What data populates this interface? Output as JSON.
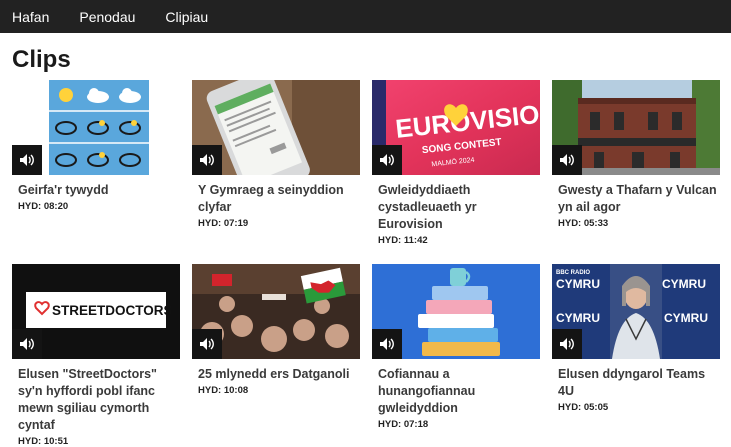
{
  "nav": {
    "items": [
      "Hafan",
      "Penodau",
      "Clipiau"
    ]
  },
  "page": {
    "title": "Clips"
  },
  "clips": [
    {
      "title": "Geirfa'r tywydd",
      "duration": "HYD: 08:20",
      "thumb": "weather-icons-grid"
    },
    {
      "title": "Y Gymraeg a seinyddion clyfar",
      "duration": "HYD: 07:19",
      "thumb": "phone-app-screenshot"
    },
    {
      "title": "Gwleidyddiaeth cystadleuaeth yr Eurovision",
      "duration": "HYD: 11:42",
      "thumb": "eurovision-banner",
      "thumb_text": [
        "EUROVISION",
        "SONG CONTEST",
        "MALMÖ 2024"
      ]
    },
    {
      "title": "Gwesty a Thafarn y Vulcan yn ail agor",
      "duration": "HYD: 05:33",
      "thumb": "vulcan-hotel-photo"
    },
    {
      "title": "Elusen \"StreetDoctors\" sy'n hyffordi pobl ifanc mewn sgiliau cymorth cyntaf",
      "duration": "HYD: 10:51",
      "thumb": "streetdoctors-logo",
      "thumb_text": [
        "STREETDOCTORS"
      ]
    },
    {
      "title": "25 mlynedd ers Datganoli",
      "duration": "HYD: 10:08",
      "thumb": "crowd-welsh-flags"
    },
    {
      "title": "Cofiannau a hunangofiannau gwleidyddion",
      "duration": "HYD: 07:18",
      "thumb": "books-stack-illustration"
    },
    {
      "title": "Elusen ddyngarol Teams 4U",
      "duration": "HYD: 05:05",
      "thumb": "radio-cymru-portrait",
      "thumb_text": [
        "BBC RADIO",
        "CYMRU"
      ]
    }
  ]
}
